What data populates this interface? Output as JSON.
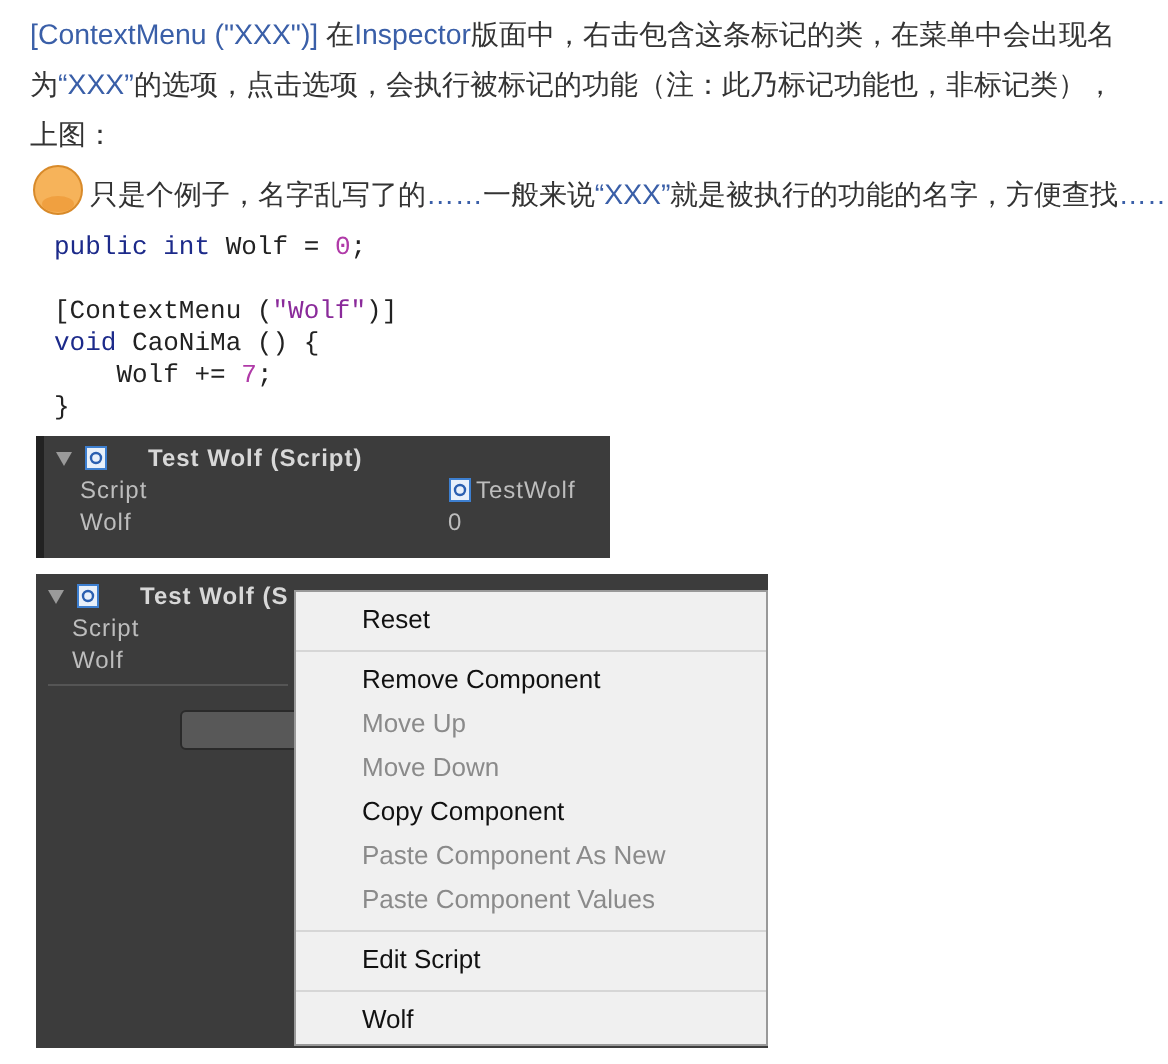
{
  "intro": {
    "segments": [
      {
        "text": "[ContextMenu (\"XXX\")]",
        "accent": true
      },
      {
        "text": " 在",
        "accent": false
      },
      {
        "text": "Inspector",
        "accent": true
      },
      {
        "text": "版面中，右击包含这条标记的类，在菜单中会出现名为",
        "accent": false
      },
      {
        "text": "“XXX”",
        "accent": true
      },
      {
        "text": "的选项，点击选项，会执行被标记的功能（注：此乃标记功能也，非标记类），上图：",
        "accent": false
      }
    ]
  },
  "note": {
    "segments": [
      {
        "text": "只是个例子，名字乱写了的",
        "accent": false
      },
      {
        "text": "……",
        "accent": true
      },
      {
        "text": "一般来说",
        "accent": false
      },
      {
        "text": "“XXX”",
        "accent": true
      },
      {
        "text": "就是被执行的功能的名字，方便查找",
        "accent": false
      },
      {
        "text": "……",
        "accent": true
      }
    ]
  },
  "code": [
    {
      "lines": [
        {
          "tokens": [
            {
              "text": "public int",
              "kind": "keyword"
            },
            {
              "text": " Wolf = ",
              "kind": "plain"
            },
            {
              "text": "0",
              "kind": "number"
            },
            {
              "text": ";",
              "kind": "plain"
            }
          ]
        }
      ]
    },
    {
      "lines": [
        {
          "tokens": [
            {
              "text": "[ContextMenu (",
              "kind": "plain"
            },
            {
              "text": "\"Wolf\"",
              "kind": "string"
            },
            {
              "text": ")]",
              "kind": "plain"
            }
          ]
        },
        {
          "tokens": [
            {
              "text": "void",
              "kind": "keyword"
            },
            {
              "text": " CaoNiMa () {",
              "kind": "plain"
            }
          ]
        },
        {
          "tokens": [
            {
              "text": "    Wolf += ",
              "kind": "plain"
            },
            {
              "text": "7",
              "kind": "number"
            },
            {
              "text": ";",
              "kind": "plain"
            }
          ]
        },
        {
          "tokens": [
            {
              "text": "}",
              "kind": "plain"
            }
          ]
        }
      ]
    }
  ],
  "inspector": {
    "title": "Test Wolf (Script)",
    "rows": [
      {
        "label": "Script",
        "value": "TestWolf",
        "kind": "script"
      },
      {
        "label": "Wolf",
        "value": "0",
        "kind": "number"
      }
    ]
  },
  "inspector_with_menu": {
    "title": "Test Wolf (S",
    "rows": [
      {
        "label": "Script"
      },
      {
        "label": "Wolf"
      }
    ],
    "context_menu": [
      {
        "label": "Reset",
        "disabled": false,
        "divider_after": true
      },
      {
        "label": "Remove Component",
        "disabled": false,
        "divider_after": false
      },
      {
        "label": "Move Up",
        "disabled": true,
        "divider_after": false
      },
      {
        "label": "Move Down",
        "disabled": true,
        "divider_after": false
      },
      {
        "label": "Copy Component",
        "disabled": false,
        "divider_after": false
      },
      {
        "label": "Paste Component As New",
        "disabled": true,
        "divider_after": false
      },
      {
        "label": "Paste Component Values",
        "disabled": true,
        "divider_after": true
      },
      {
        "label": "Edit Script",
        "disabled": false,
        "divider_after": true
      },
      {
        "label": "Wolf",
        "disabled": false,
        "divider_after": false
      }
    ]
  }
}
